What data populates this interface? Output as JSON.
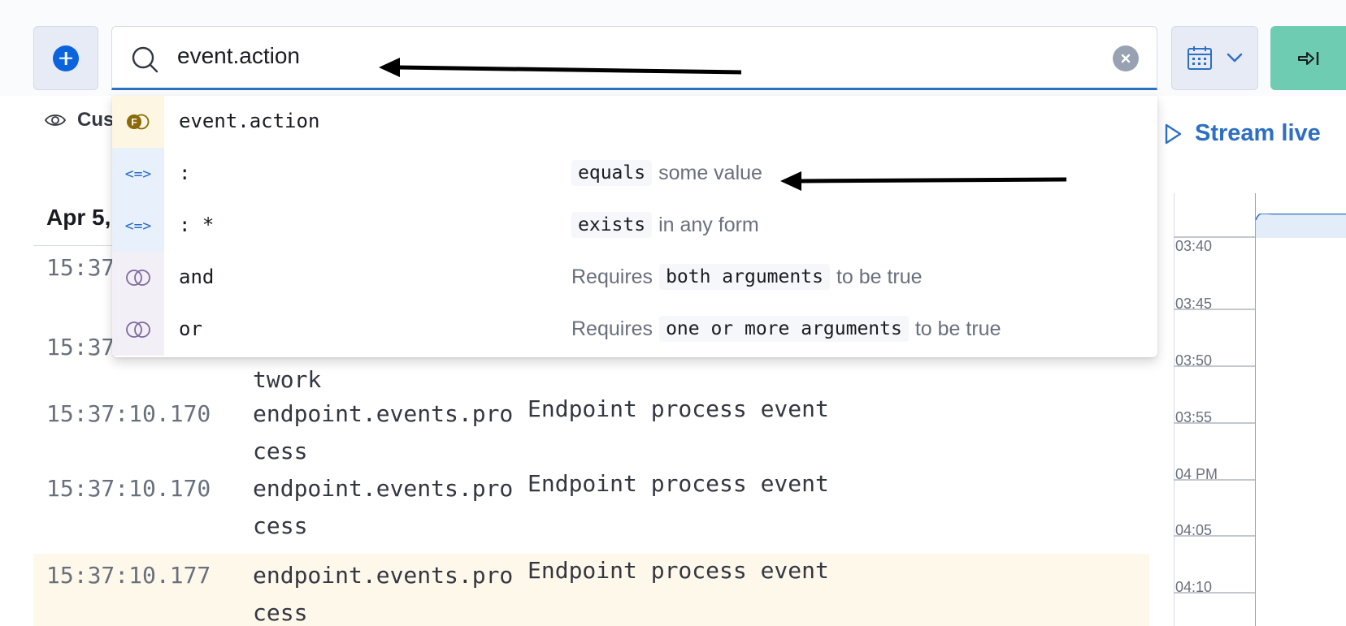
{
  "search": {
    "query": "event.action"
  },
  "customize": {
    "label": "Cus"
  },
  "stream": {
    "label": "Stream live"
  },
  "log": {
    "date_header": "Apr 5,",
    "rows": [
      {
        "time": "15:37",
        "dataset": "",
        "message": ""
      },
      {
        "time": "15:37",
        "dataset": "twork",
        "message": ""
      },
      {
        "time": "15:37:10.170",
        "dataset": "endpoint.events.process",
        "message": "Endpoint process event"
      },
      {
        "time": "15:37:10.170",
        "dataset": "endpoint.events.process",
        "message": "Endpoint process event"
      },
      {
        "time": "15:37:10.177",
        "dataset": "endpoint.events.process",
        "message": "Endpoint process event"
      }
    ]
  },
  "timeline": {
    "ticks": [
      "03:40",
      "03:45",
      "03:50",
      "03:55",
      "04 PM",
      "04:05",
      "04:10"
    ]
  },
  "suggestions": [
    {
      "kind": "field",
      "text": "event.action",
      "desc_pre": "",
      "desc_code": "",
      "desc_post": ""
    },
    {
      "kind": "operator",
      "badge": "<=>",
      "text": ":",
      "desc_pre": "",
      "desc_code": "equals",
      "desc_post": "some value"
    },
    {
      "kind": "operator",
      "badge": "<=>",
      "text": ": *",
      "desc_pre": "",
      "desc_code": "exists",
      "desc_post": "in any form"
    },
    {
      "kind": "conjunction",
      "text": "and",
      "desc_pre": "Requires",
      "desc_code": "both arguments",
      "desc_post": "to be true"
    },
    {
      "kind": "conjunction",
      "text": "or",
      "desc_pre": "Requires",
      "desc_code": "one or more arguments",
      "desc_post": "to be true"
    }
  ],
  "colors": {
    "accent": "#2c6fc4",
    "add_button": "#0b64dd",
    "run_button": "#6dccb1",
    "highlight_row": "#fef8ea",
    "field_badge": "#8a6a0a"
  },
  "icons": {
    "add": "plus-circle-icon",
    "search": "search-icon",
    "clear": "clear-icon",
    "calendar": "calendar-icon",
    "run": "arrow-to-end-icon",
    "eye": "eye-icon",
    "play": "play-icon"
  }
}
